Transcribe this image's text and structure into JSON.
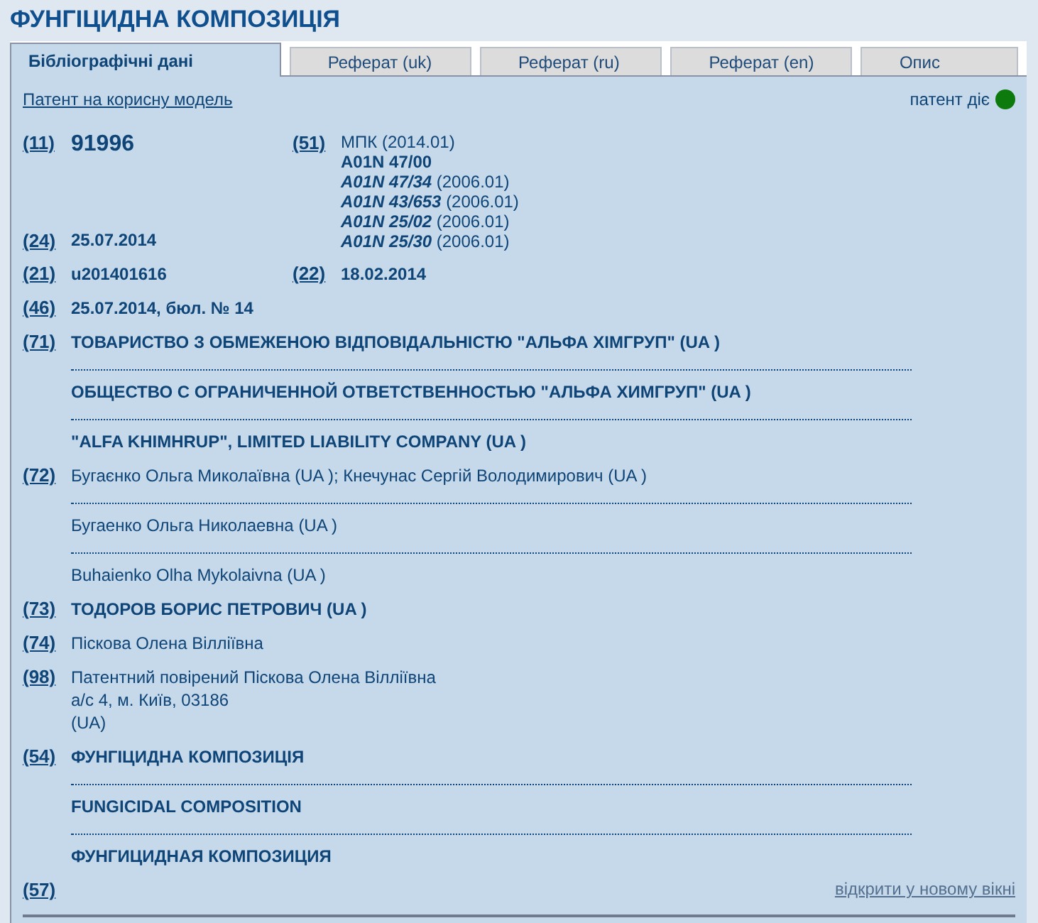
{
  "title": "ФУНГІЦИДНА КОМПОЗИЦІЯ",
  "tabs": [
    {
      "label": "Бібліографічні дані",
      "selected": true
    },
    {
      "label": "Реферат (uk)",
      "selected": false
    },
    {
      "label": "Реферат (ru)",
      "selected": false
    },
    {
      "label": "Реферат (en)",
      "selected": false
    },
    {
      "label": "Опис",
      "selected": false
    }
  ],
  "document_type_link": "Патент на корисну модель",
  "status": {
    "label": "патент діє",
    "active": true
  },
  "top": {
    "left": [
      {
        "code": "(11)",
        "value": "91996",
        "large": true
      },
      {
        "code": "(24)",
        "value": "25.07.2014",
        "large": false
      }
    ],
    "right": {
      "code": "(51)",
      "heading": "МПК (2014.01)",
      "classes": [
        {
          "class": "A01N 47/00",
          "main": true
        },
        {
          "class": "A01N 47/34",
          "version": "(2006.01)",
          "main": false
        },
        {
          "class": "A01N 43/653",
          "version": "(2006.01)",
          "main": false
        },
        {
          "class": "A01N 25/02",
          "version": "(2006.01)",
          "main": false
        },
        {
          "class": "A01N 25/30",
          "version": "(2006.01)",
          "main": false
        }
      ]
    }
  },
  "sections": [
    {
      "kind": "pair",
      "items": [
        {
          "code": "(21)",
          "value": "u201401616"
        },
        {
          "code": "(22)",
          "value": "18.02.2014"
        }
      ]
    },
    {
      "kind": "entries",
      "code": "(46)",
      "bold": true,
      "entries": [
        "25.07.2014, бюл. № 14"
      ]
    },
    {
      "kind": "entries",
      "code": "(71)",
      "bold": true,
      "entries": [
        "ТОВАРИСТВО З ОБМЕЖЕНОЮ ВІДПОВІДАЛЬНІСТЮ \"АЛЬФА ХІМГРУП\" (UA )",
        "ОБЩЕСТВО С ОГРАНИЧЕННОЙ ОТВЕТСТВЕННОСТЬЮ \"АЛЬФА ХИМГРУП\" (UA )",
        "\"ALFA KHIMHRUP\", LIMITED LIABILITY COMPANY (UA )"
      ]
    },
    {
      "kind": "entries",
      "code": "(72)",
      "bold": false,
      "entries": [
        "Бугаєнко Ольга Миколаївна (UA ); Кнечунас Сергій Володимирович (UA )",
        "Бугаенко Ольга Николаевна (UA )",
        "Buhaienko Olha Mykolaivna (UA )"
      ]
    },
    {
      "kind": "entries",
      "code": "(73)",
      "bold": true,
      "entries": [
        "ТОДОРОВ БОРИС ПЕТРОВИЧ (UA )"
      ]
    },
    {
      "kind": "entries",
      "code": "(74)",
      "bold": false,
      "entries": [
        "Піскова Олена Вілліївна"
      ]
    },
    {
      "kind": "address",
      "code": "(98)",
      "lines": [
        "Патентний повірений Піскова Олена Вілліївна",
        "а/с 4, м. Київ, 03186",
        "(UA)"
      ]
    },
    {
      "kind": "entries",
      "code": "(54)",
      "bold": true,
      "entries": [
        "ФУНГІЦИДНА КОМПОЗИЦІЯ",
        "FUNGICIDAL COMPOSITION",
        "ФУНГИЦИДНАЯ КОМПОЗИЦИЯ"
      ]
    },
    {
      "kind": "link",
      "code": "(57)",
      "link": "відкрити у новому вікні"
    }
  ]
}
